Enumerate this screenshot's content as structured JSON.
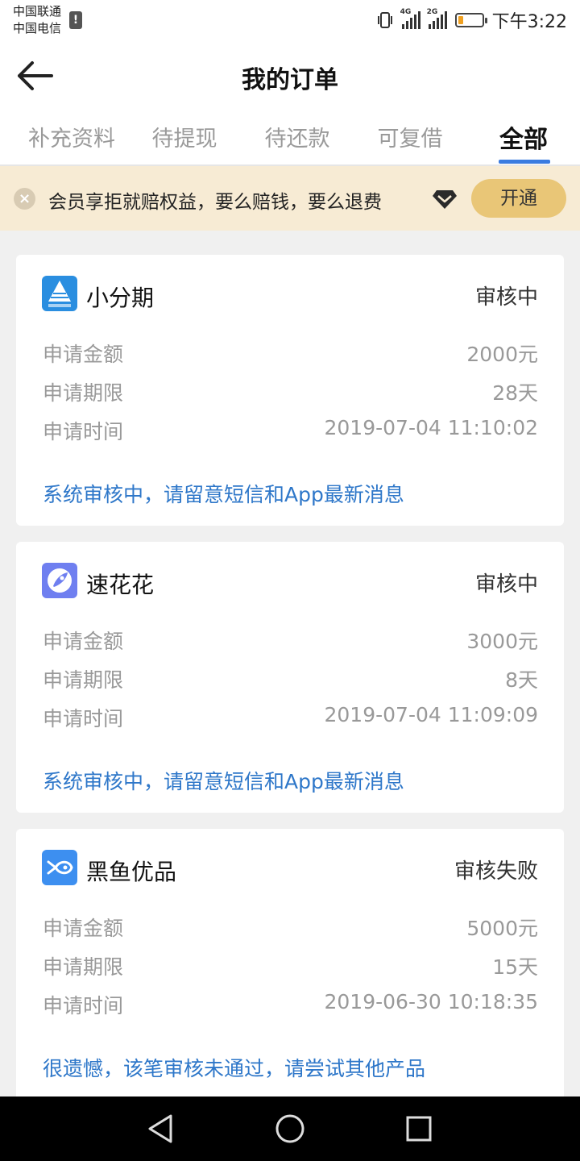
{
  "status_bar": {
    "carrier_1": "中国联通",
    "carrier_2": "中国电信",
    "sim_alert": "!",
    "net_1": "4G",
    "net_2": "2G",
    "time": "下午3:22",
    "battery_level": 0.2,
    "battery_color": "#f0a020"
  },
  "header": {
    "back_icon": "arrow-left-icon",
    "title": "我的订单"
  },
  "tabs": [
    {
      "label": "补充资料",
      "active": false
    },
    {
      "label": "待提现",
      "active": false
    },
    {
      "label": "待还款",
      "active": false
    },
    {
      "label": "可复借",
      "active": false
    },
    {
      "label": "全部",
      "active": true
    }
  ],
  "promo": {
    "close_icon": "close-circle-icon",
    "text": "会员享拒就赔权益，要么赔钱，要么退费",
    "badge_icon": "diamond-icon",
    "button_label": "开通"
  },
  "orders": [
    {
      "name": "小分期",
      "logo_icon": "pyramid-logo-icon",
      "status": "审核中",
      "rows": [
        {
          "label": "申请金额",
          "value": "2000元"
        },
        {
          "label": "申请期限",
          "value": "28天"
        },
        {
          "label": "申请时间",
          "value": "2019-07-04 11:10:02"
        }
      ],
      "message": "系统审核中，请留意短信和App最新消息"
    },
    {
      "name": "速花花",
      "logo_icon": "rocket-logo-icon",
      "status": "审核中",
      "rows": [
        {
          "label": "申请金额",
          "value": "3000元"
        },
        {
          "label": "申请期限",
          "value": "8天"
        },
        {
          "label": "申请时间",
          "value": "2019-07-04 11:09:09"
        }
      ],
      "message": "系统审核中，请留意短信和App最新消息"
    },
    {
      "name": "黑鱼优品",
      "logo_icon": "fish-logo-icon",
      "status": "审核失败",
      "rows": [
        {
          "label": "申请金额",
          "value": "5000元"
        },
        {
          "label": "申请期限",
          "value": "15天"
        },
        {
          "label": "申请时间",
          "value": "2019-06-30 10:18:35"
        }
      ],
      "message": "很遗憾，该笔审核未通过，请尝试其他产品"
    }
  ],
  "colors": {
    "accent_blue": "#2e77c9",
    "tab_underline": "#3a7be0",
    "promo_bg": "#f7ebd4",
    "promo_button": "#e9c677"
  },
  "nav": {
    "back": "triangle-back-icon",
    "home": "circle-home-icon",
    "recent": "square-recent-icon"
  }
}
